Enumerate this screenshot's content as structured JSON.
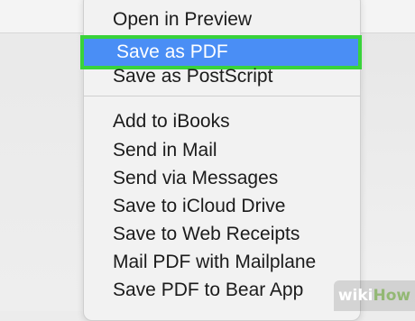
{
  "menu": {
    "items": [
      {
        "label": "Open in Preview"
      },
      {
        "label": "Save as PDF",
        "selected": true
      },
      {
        "label": "Save as PostScript"
      },
      {
        "label": "Add to iBooks"
      },
      {
        "label": "Send in Mail"
      },
      {
        "label": "Send via Messages"
      },
      {
        "label": "Save to iCloud Drive"
      },
      {
        "label": "Save to Web Receipts"
      },
      {
        "label": "Mail PDF with Mailplane"
      },
      {
        "label": "Save PDF to Bear App"
      }
    ]
  },
  "watermark": {
    "part1": "wiki",
    "part2": "How"
  },
  "colors": {
    "selection": "#4a8ef5",
    "highlight_border": "#39d33a",
    "menu_bg": "#f2f2f2",
    "text": "#1b1b1b"
  }
}
